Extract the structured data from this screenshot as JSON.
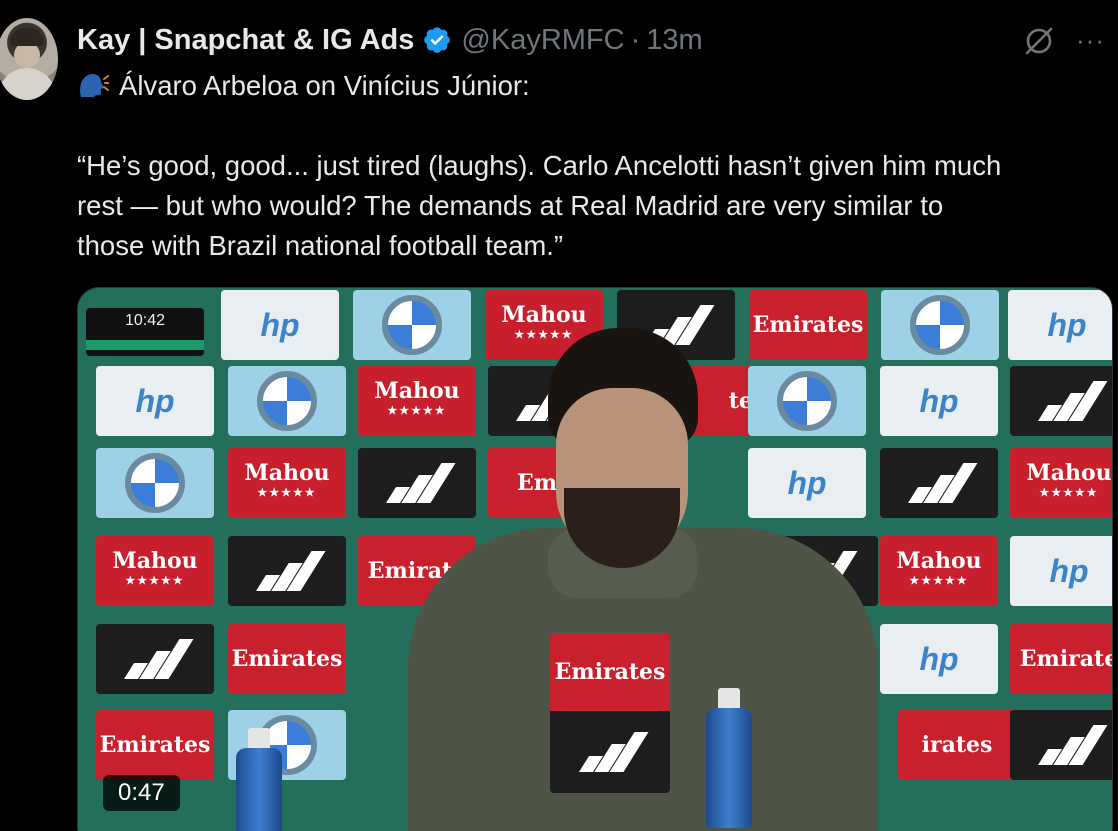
{
  "tweet": {
    "author_name": "Kay | Snapchat & IG Ads",
    "handle": "@KayRMFC",
    "separator": "·",
    "time": "13m",
    "verified": true,
    "icons": {
      "verified": "verified-badge-icon",
      "grok": "grok-icon",
      "more": "more-icon",
      "speaking": "speaking-head-icon"
    },
    "text": {
      "line1": "Álvaro Arbeloa on Vinícius Júnior:",
      "line2": "“He’s good, good... just tired (laughs). Carlo Ancelotti hasn’t given him much",
      "line3": "rest — but who would? The demands at Real Madrid are very similar to",
      "line4": "those with Brazil national football team.”"
    },
    "media": {
      "duration": "0:47",
      "clock": "10:42"
    }
  },
  "colors": {
    "background": "#000000",
    "text": "#e7e9ea",
    "secondary": "#71767b",
    "verified": "#1d9bf0"
  }
}
